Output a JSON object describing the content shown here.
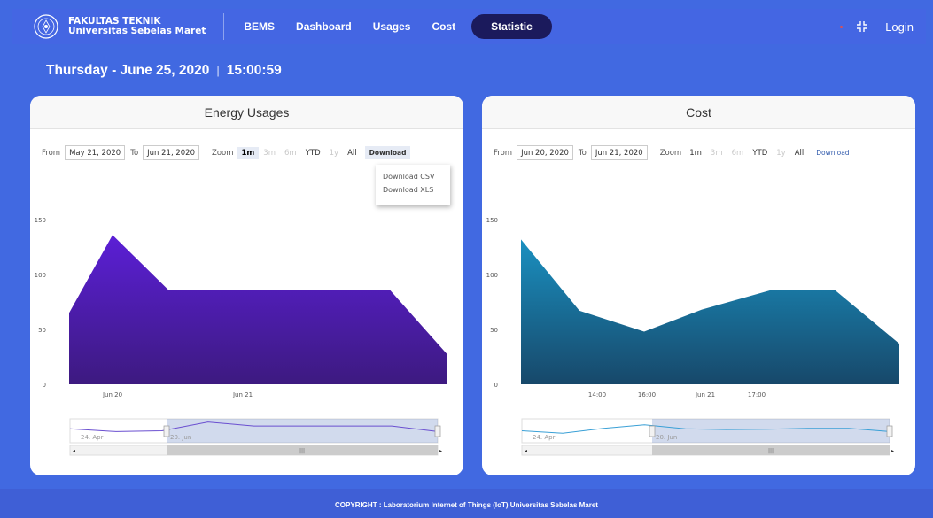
{
  "navbar": {
    "brand_line1": "FAKULTAS TEKNIK",
    "brand_line2": "Universitas Sebelas Maret",
    "items": [
      {
        "label": "BEMS"
      },
      {
        "label": "Dashboard"
      },
      {
        "label": "Usages"
      },
      {
        "label": "Cost"
      }
    ],
    "active": "Statistic",
    "login": "Login",
    "icons": [
      "university-logo-icon",
      "compress-icon"
    ]
  },
  "header": {
    "date": "Thursday - June 25, 2020",
    "separator": "|",
    "time": "15:00:59"
  },
  "energy": {
    "title": "Energy Usages",
    "from_label": "From",
    "from_value": "May 21, 2020",
    "to_label": "To",
    "to_value": "Jun 21, 2020",
    "zoom_label": "Zoom",
    "zoom_buttons": [
      "1m",
      "3m",
      "6m",
      "YTD",
      "1y",
      "All"
    ],
    "download_label": "Download",
    "download_options": [
      "Download CSV",
      "Download XLS"
    ],
    "x_labels": [
      "Jun 20",
      "Jun 21"
    ],
    "navigator_labels": [
      "24. Apr",
      "20. Jun"
    ]
  },
  "cost": {
    "title": "Cost",
    "from_label": "From",
    "from_value": "Jun 20, 2020",
    "to_label": "To",
    "to_value": "Jun 21, 2020",
    "zoom_label": "Zoom",
    "zoom_buttons": [
      "1m",
      "3m",
      "6m",
      "YTD",
      "1y",
      "All"
    ],
    "download_label": "Download",
    "x_labels": [
      "14:00",
      "16:00",
      "Jun 21",
      "17:00"
    ],
    "navigator_labels": [
      "24. Apr",
      "20. Jun"
    ]
  },
  "footer": {
    "copyright": "COPYRIGHT : Laboratorium Internet of Things (IoT) Universitas Sebelas Maret"
  },
  "colors": {
    "page_bg": "#4169e1",
    "nav_active": "#1b1a5c",
    "energy_top": "#5b1fd6",
    "energy_bottom": "#3d1a80",
    "cost_top": "#1a90c0",
    "cost_bottom": "#17486a"
  },
  "chart_data": [
    {
      "type": "area",
      "title": "Energy Usages",
      "x": [
        "Jun 19 23:00",
        "Jun 20 01:00",
        "Jun 20 08:00",
        "Jun 21 12:00",
        "Jun 21 16:00"
      ],
      "values": [
        65,
        136,
        86,
        86,
        27
      ],
      "ylim": [
        0,
        150
      ],
      "yticks": [
        0,
        50,
        100,
        150
      ],
      "grid": false,
      "navigator": [
        35,
        28,
        30,
        52,
        42,
        42,
        42,
        42,
        28
      ]
    },
    {
      "type": "area",
      "title": "Cost",
      "x": [
        "13:00",
        "14:00",
        "15:00",
        "16:00",
        "17:00",
        "17:30",
        "18:30"
      ],
      "values": [
        132,
        67,
        48,
        68,
        86,
        86,
        37
      ],
      "ylim": [
        0,
        150
      ],
      "yticks": [
        0,
        50,
        100,
        150
      ],
      "grid": false,
      "navigator": [
        30,
        24,
        36,
        45,
        35,
        33,
        34,
        36,
        36,
        28
      ]
    }
  ]
}
